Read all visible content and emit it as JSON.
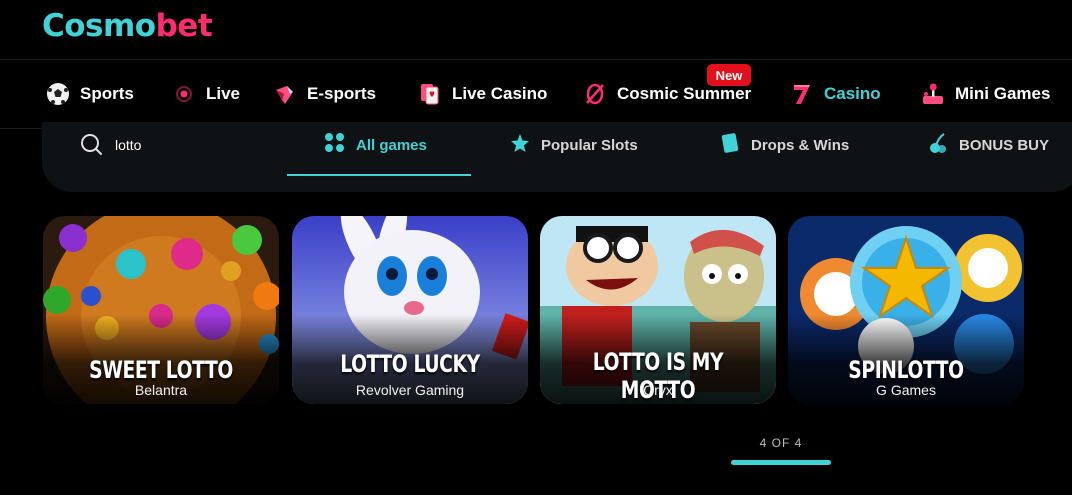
{
  "brand": {
    "logo_text_a": "Cosmo",
    "logo_text_b": "bet"
  },
  "nav": {
    "items": [
      {
        "label": "Sports",
        "icon": "soccer-ball-icon"
      },
      {
        "label": "Live",
        "icon": "live-dot-icon"
      },
      {
        "label": "E-sports",
        "icon": "gamepad-icon"
      },
      {
        "label": "Live Casino",
        "icon": "playing-cards-icon"
      },
      {
        "label": "Cosmic Summer",
        "icon": "cosmic-summer-icon"
      },
      {
        "label": "Casino",
        "icon": "lucky-seven-icon"
      },
      {
        "label": "Mini Games",
        "icon": "arcade-joystick-icon"
      }
    ],
    "active": "Casino",
    "badge": "New"
  },
  "search": {
    "value": "lotto"
  },
  "tabs": [
    {
      "label": "All games",
      "icon": "grid-dots-icon"
    },
    {
      "label": "Popular Slots",
      "icon": "star-icon"
    },
    {
      "label": "Drops & Wins",
      "icon": "card-icon"
    },
    {
      "label": "BONUS BUY",
      "icon": "cherries-icon"
    }
  ],
  "games": [
    {
      "title": "SWEET LOTTO",
      "provider": "Belantra"
    },
    {
      "title": "LOTTO LUCKY",
      "provider": "Revolver Gaming"
    },
    {
      "title": "LOTTO IS MY MOTTO",
      "provider": "Oryx"
    },
    {
      "title": "SPINLOTTO",
      "provider": "G Games"
    }
  ],
  "pager": {
    "text": "4 OF 4"
  },
  "colors": {
    "accent": "#3fd3d8",
    "brand_pink": "#ff2d6f",
    "badge_red": "#e2101c"
  }
}
